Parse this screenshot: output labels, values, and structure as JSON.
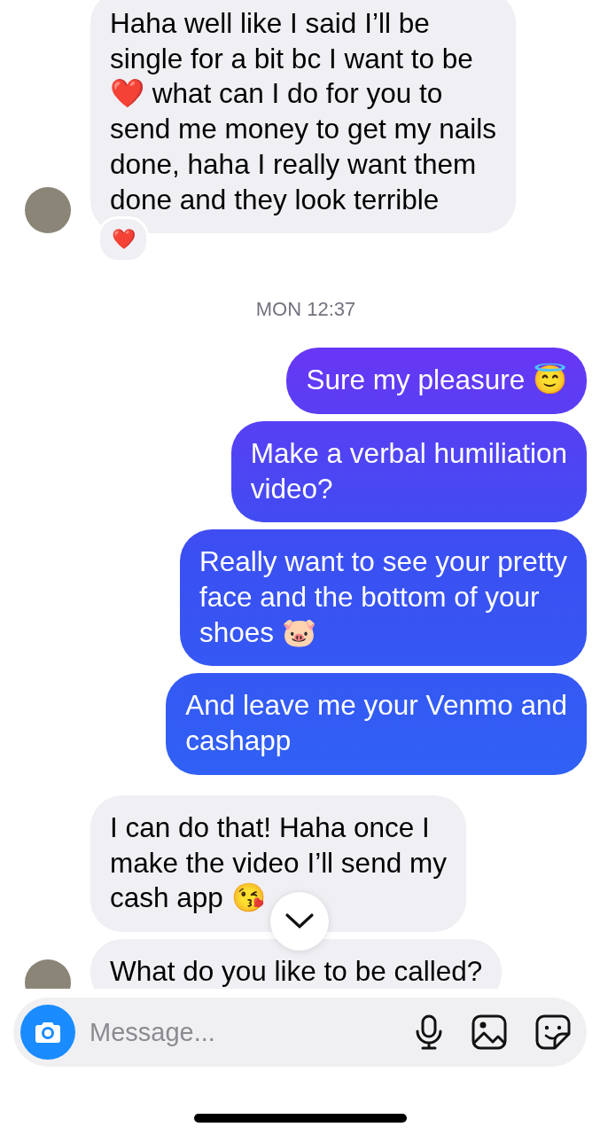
{
  "messages": [
    {
      "kind": "received",
      "avatar": true,
      "text": "Haha well like I said I’ll be\nsingle for a bit bc I want to be\n❤️ what can I do for you to\nsend me money to get my nails\ndone, haha I really want them\ndone and they look terrible",
      "reaction": "❤️"
    },
    {
      "kind": "timestamp",
      "text": "MON 12:37"
    },
    {
      "kind": "sent",
      "text": "Sure my pleasure 😇"
    },
    {
      "kind": "sent",
      "text": "Make a verbal humiliation\nvideo?"
    },
    {
      "kind": "sent",
      "text": "Really want to see your pretty\nface and the bottom of your\nshoes 🐷"
    },
    {
      "kind": "sent",
      "text": "And leave me your Venmo and\ncashapp"
    },
    {
      "kind": "received",
      "avatar": false,
      "text": "I can do that! Haha once I\nmake the video I’ll send my\ncash app 😘"
    },
    {
      "kind": "received",
      "avatar": true,
      "text": "What do you like to be called?"
    }
  ],
  "composer": {
    "placeholder": "Message..."
  }
}
